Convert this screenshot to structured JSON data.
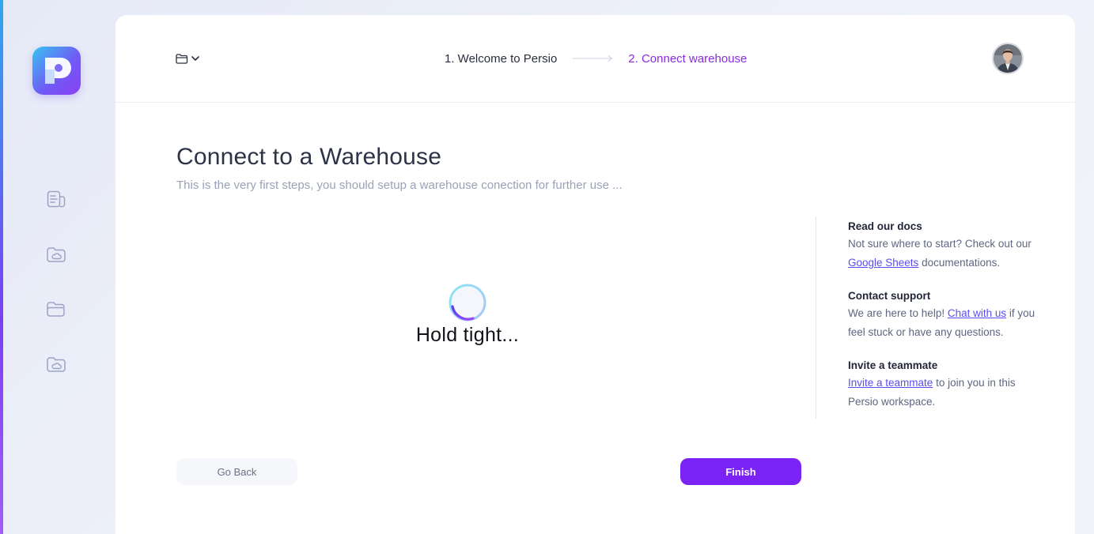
{
  "app": {
    "logo_icon": "persio-logo-icon",
    "colors": {
      "accent": "#7b22f5",
      "step_active": "#8a2be2",
      "link": "#5a4cf0"
    }
  },
  "sidebar": {
    "items": [
      {
        "icon": "document-icon"
      },
      {
        "icon": "cloud-folder-icon"
      },
      {
        "icon": "open-folder-icon"
      },
      {
        "icon": "cloud-folder-icon"
      }
    ]
  },
  "header": {
    "folder_dropdown_icon": "folder-icon",
    "steps": [
      {
        "label": "1. Welcome to Persio",
        "state": "done"
      },
      {
        "label": "2. Connect warehouse",
        "state": "active"
      }
    ],
    "avatar_icon": "user-avatar"
  },
  "main": {
    "title": "Connect to a Warehouse",
    "subtitle": "This is the very first steps, you should setup a warehouse conection for further use ...",
    "loader_text": "Hold tight..."
  },
  "help": {
    "docs": {
      "title": "Read our docs",
      "text_before": "Not sure where to start? Check out our ",
      "link": "Google Sheets",
      "text_after": " documentations."
    },
    "support": {
      "title": "Contact support",
      "text_before": "We are here to help! ",
      "link": "Chat with us",
      "text_after": " if you feel stuck or have any questions."
    },
    "invite": {
      "title": "Invite a teammate",
      "link": "Invite a teammate",
      "text_after": " to join you in this Persio workspace."
    }
  },
  "actions": {
    "back_label": "Go Back",
    "finish_label": "Finish"
  }
}
